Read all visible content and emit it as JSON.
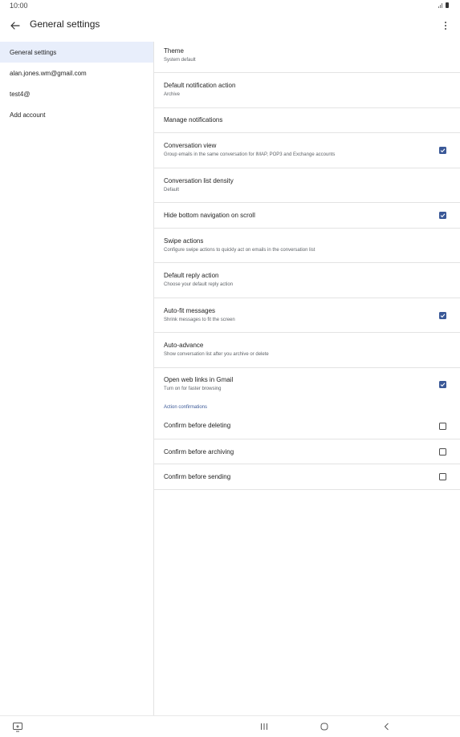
{
  "status_bar": {
    "time": "10:00",
    "icons": [
      "signal-icon",
      "battery-icon"
    ]
  },
  "app_bar": {
    "title": "General settings",
    "back_icon": "arrow-back-icon",
    "menu_icon": "more-vert-icon"
  },
  "sidebar": {
    "items": [
      {
        "label": "General settings",
        "active": true
      },
      {
        "label": "alan.jones.wm@gmail.com",
        "active": false
      },
      {
        "label": "test4@",
        "active": false
      },
      {
        "label": "Add account",
        "active": false
      }
    ]
  },
  "settings": {
    "theme": {
      "title": "Theme",
      "subtitle": "System default"
    },
    "default_notification_action": {
      "title": "Default notification action",
      "subtitle": "Archive"
    },
    "manage_notifications": {
      "title": "Manage notifications"
    },
    "conversation_view": {
      "title": "Conversation view",
      "subtitle": "Group emails in the same conversation for IMAP, POP3 and Exchange accounts",
      "checked": true
    },
    "conversation_list_density": {
      "title": "Conversation list density",
      "subtitle": "Default"
    },
    "hide_bottom_navigation": {
      "title": "Hide bottom navigation on scroll",
      "checked": true
    },
    "swipe_actions": {
      "title": "Swipe actions",
      "subtitle": "Configure swipe actions to quickly act on emails in the conversation list"
    },
    "default_reply_action": {
      "title": "Default reply action",
      "subtitle": "Choose your default reply action"
    },
    "auto_fit_messages": {
      "title": "Auto-fit messages",
      "subtitle": "Shrink messages to fit the screen",
      "checked": true
    },
    "auto_advance": {
      "title": "Auto-advance",
      "subtitle": "Show conversation list after you archive or delete"
    },
    "open_web_links": {
      "title": "Open web links in Gmail",
      "subtitle": "Turn on for faster browsing",
      "checked": true
    },
    "action_confirmations_label": "Action confirmations",
    "confirm_deleting": {
      "title": "Confirm before deleting",
      "checked": false
    },
    "confirm_archiving": {
      "title": "Confirm before archiving",
      "checked": false
    },
    "confirm_sending": {
      "title": "Confirm before sending",
      "checked": false
    }
  },
  "nav_bar": {
    "icons": [
      "screenshot-icon",
      "recent-apps-icon",
      "home-icon",
      "back-nav-icon"
    ]
  },
  "colors": {
    "accent": "#3a5897",
    "sidebar_active": "#e8eefb",
    "divider": "#e3e3e3"
  }
}
